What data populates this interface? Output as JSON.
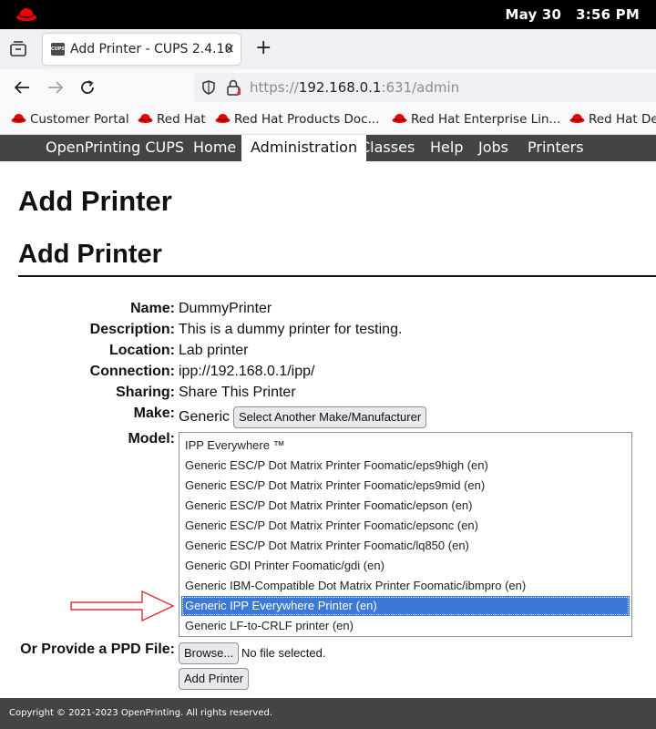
{
  "system": {
    "date": "May 30",
    "time": "3:56 PM"
  },
  "browser": {
    "tab": {
      "favicon_text": "CUPS",
      "title": "Add Printer - CUPS 2.4.10",
      "close": "×"
    },
    "new_tab": "+",
    "url": {
      "scheme": "https://",
      "host": "192.168.0.1",
      "rest": ":631/admin"
    },
    "bookmarks": [
      {
        "label": "Customer Portal"
      },
      {
        "label": "Red Hat"
      },
      {
        "label": "Red Hat Products Doc..."
      },
      {
        "label": "Red Hat Enterprise Lin..."
      },
      {
        "label": "Red Hat De"
      }
    ]
  },
  "cups_nav": {
    "items": [
      "OpenPrinting CUPS",
      "Home",
      "Administration",
      "Classes",
      "Help",
      "Jobs",
      "Printers"
    ],
    "active": "Administration"
  },
  "page": {
    "h1": "Add Printer",
    "h2": "Add Printer",
    "fields": {
      "name_label": "Name:",
      "name_value": "DummyPrinter",
      "description_label": "Description:",
      "description_value": "This is a dummy printer for testing.",
      "location_label": "Location:",
      "location_value": "Lab printer",
      "connection_label": "Connection:",
      "connection_value": "ipp://192.168.0.1/ipp/",
      "sharing_label": "Sharing:",
      "sharing_value": "Share This Printer",
      "make_label": "Make:",
      "make_value": "Generic",
      "make_button": "Select Another Make/Manufacturer",
      "model_label": "Model:",
      "model_options": [
        "IPP Everywhere ™",
        "Generic ESC/P Dot Matrix Printer Foomatic/eps9high (en)",
        "Generic ESC/P Dot Matrix Printer Foomatic/eps9mid (en)",
        "Generic ESC/P Dot Matrix Printer Foomatic/epson (en)",
        "Generic ESC/P Dot Matrix Printer Foomatic/epsonc (en)",
        "Generic ESC/P Dot Matrix Printer Foomatic/lq850 (en)",
        "Generic GDI Printer Foomatic/gdi (en)",
        "Generic IBM-Compatible Dot Matrix Printer Foomatic/ibmpro (en)",
        "Generic IPP Everywhere Printer (en)",
        "Generic LF-to-CRLF printer (en)"
      ],
      "model_selected": "Generic IPP Everywhere Printer (en)",
      "ppd_label": "Or Provide a PPD File:",
      "browse_button": "Browse...",
      "file_status": "No file selected.",
      "add_button": "Add Printer"
    }
  },
  "footer": {
    "copyright": "Copyright © 2021-2023 OpenPrinting. All rights reserved."
  },
  "colors": {
    "selection": "#3b78d8",
    "cups_nav_bg": "#444444",
    "annotation_arrow": "#e03030",
    "redhat": "#ee0000"
  }
}
